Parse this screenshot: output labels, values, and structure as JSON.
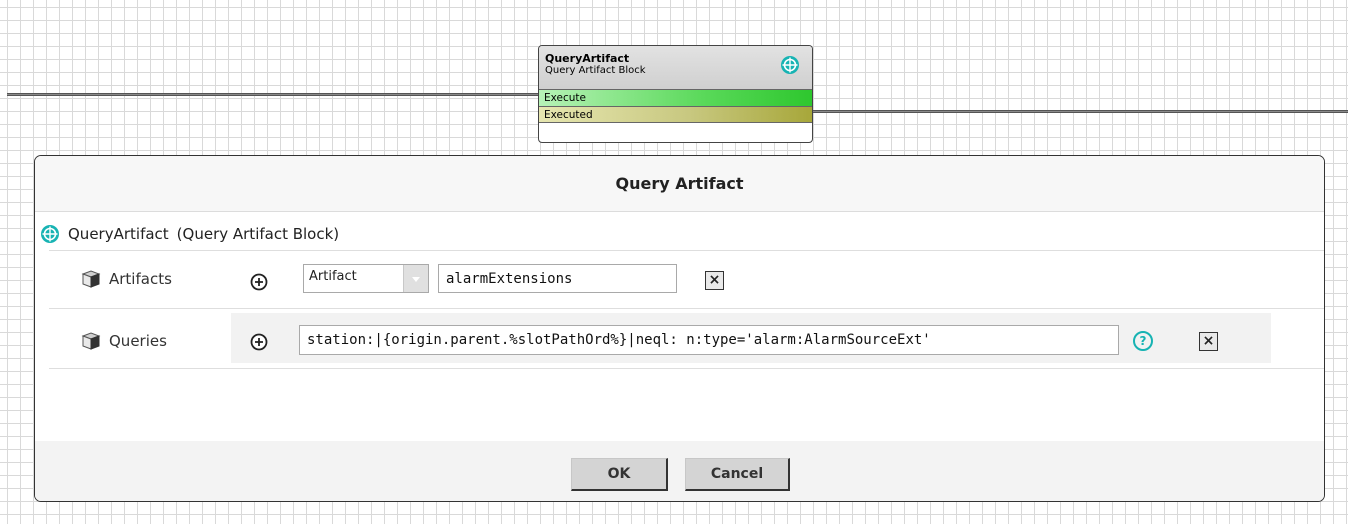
{
  "block": {
    "name": "QueryArtifact",
    "type": "Query Artifact Block",
    "slots": [
      "Execute",
      "Executed"
    ],
    "icon": "target-icon"
  },
  "dialog": {
    "title": "Query  Artifact",
    "header_name": "QueryArtifact",
    "header_type": "(Query Artifact Block)",
    "artifacts": {
      "label": "Artifacts",
      "select_value": "Artifact",
      "input_value": "alarmExtensions"
    },
    "queries": {
      "label": "Queries",
      "input_value": "station:|{origin.parent.%slotPathOrd%}|neql: n:type='alarm:AlarmSourceExt'"
    },
    "help_label": "?",
    "remove_label": "×",
    "ok_label": "OK",
    "cancel_label": "Cancel"
  },
  "colors": {
    "accent": "#17b3b3",
    "execute_slot": "#2ec72e",
    "executed_slot": "#a7a73a"
  }
}
